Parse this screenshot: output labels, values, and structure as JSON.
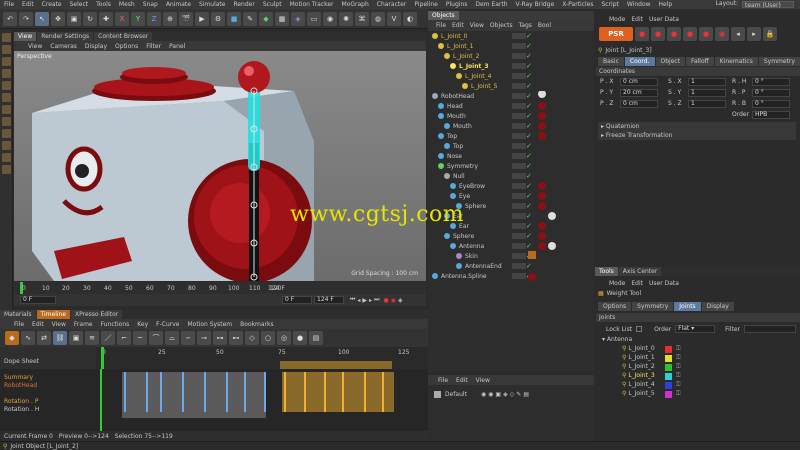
{
  "menubar": {
    "items": [
      "File",
      "Edit",
      "Create",
      "Select",
      "Tools",
      "Mesh",
      "Snap",
      "Animate",
      "Simulate",
      "Render",
      "Sculpt",
      "Motion Tracker",
      "MoGraph",
      "Character",
      "Pipeline",
      "Plugins",
      "Dem Earth",
      "V-Ray Bridge",
      "X-Particles",
      "Script",
      "Window",
      "Help"
    ],
    "layout_label": "Layout:",
    "layout_value": "team (User)"
  },
  "viewport": {
    "tabs": [
      "View",
      "Render Settings",
      "Content Browser"
    ],
    "menu": [
      "View",
      "Cameras",
      "Display",
      "Options",
      "Filter",
      "Panel"
    ],
    "camera_label": "Perspective",
    "grid_spacing": "Grid Spacing : 100 cm"
  },
  "ruler": {
    "ticks": [
      "0",
      "10",
      "20",
      "30",
      "40",
      "50",
      "60",
      "70",
      "80",
      "90",
      "100",
      "110",
      "120"
    ],
    "end_frame": "124 F"
  },
  "transport": {
    "current": "0 F",
    "start": "0 F",
    "end": "124 F",
    "field2": "0 F"
  },
  "bottom": {
    "tabs": [
      "Materials",
      "Timeline",
      "XPresso Editor"
    ],
    "menu": [
      "File",
      "Edit",
      "View",
      "Frame",
      "Functions",
      "Key",
      "F-Curve",
      "Motion System",
      "Bookmarks"
    ],
    "dopesheet_label": "Dope Sheet",
    "ruler_ticks": [
      "0",
      "25",
      "50",
      "75",
      "100",
      "125"
    ],
    "tracks": [
      {
        "name": "Summary",
        "color": "#e0a23a"
      },
      {
        "name": "RobotHead",
        "color": "#e07030"
      },
      {
        "name": "Rotation . P",
        "color": "#e0a23a"
      },
      {
        "name": "Rotation . H",
        "color": "#c8c8c8"
      }
    ],
    "status": {
      "current_frame": "Current Frame  0",
      "preview": "Preview  0-->124",
      "selection": "Selection  75-->119"
    }
  },
  "footer": {
    "status": "Joint Object [L_Joint_2]"
  },
  "objects": {
    "tab": "Objects",
    "menu": [
      "File",
      "Edit",
      "View",
      "Objects",
      "Tags",
      "Bool"
    ],
    "items": [
      {
        "name": "L_Joint_0",
        "depth": 0,
        "color": "#e0c040",
        "highlight": true
      },
      {
        "name": "L_Joint_1",
        "depth": 1,
        "color": "#e0c040",
        "highlight": true
      },
      {
        "name": "L_Joint_2",
        "depth": 2,
        "color": "#e0c040",
        "highlight": true
      },
      {
        "name": "L_Joint_3",
        "depth": 3,
        "color": "#ffe060",
        "highlight": true,
        "selected": true
      },
      {
        "name": "L_Joint_4",
        "depth": 4,
        "color": "#e0c040",
        "highlight": true
      },
      {
        "name": "L_Joint_5",
        "depth": 5,
        "color": "#e0c040",
        "highlight": true
      },
      {
        "name": "RobotHead",
        "depth": 0,
        "color": "#c8c8c8"
      },
      {
        "name": "Head",
        "depth": 1,
        "color": "#c8c8c8"
      },
      {
        "name": "Mouth",
        "depth": 1,
        "color": "#c8c8c8"
      },
      {
        "name": "Mouth",
        "depth": 2,
        "color": "#c8c8c8"
      },
      {
        "name": "Top",
        "depth": 1,
        "color": "#c8c8c8"
      },
      {
        "name": "Top",
        "depth": 2,
        "color": "#c8c8c8"
      },
      {
        "name": "Nose",
        "depth": 1,
        "color": "#c8c8c8"
      },
      {
        "name": "Symmetry",
        "depth": 1,
        "color": "#c8c8c8"
      },
      {
        "name": "Null",
        "depth": 2,
        "color": "#c8c8c8"
      },
      {
        "name": "EyeBrow",
        "depth": 3,
        "color": "#c8c8c8"
      },
      {
        "name": "Eye",
        "depth": 3,
        "color": "#c8c8c8"
      },
      {
        "name": "Sphere",
        "depth": 4,
        "color": "#c8c8c8"
      },
      {
        "name": "Ear",
        "depth": 2,
        "color": "#c8c8c8"
      },
      {
        "name": "Ear",
        "depth": 3,
        "color": "#c8c8c8"
      },
      {
        "name": "Sphere",
        "depth": 2,
        "color": "#c8c8c8"
      },
      {
        "name": "Antenna",
        "depth": 3,
        "color": "#c8c8c8"
      },
      {
        "name": "Skin",
        "depth": 4,
        "color": "#c8c8c8"
      },
      {
        "name": "AntennaEnd",
        "depth": 4,
        "color": "#c8c8c8"
      },
      {
        "name": "Antenna.Spline",
        "depth": 0,
        "color": "#c8c8c8"
      }
    ],
    "bottom_menu": [
      "File",
      "Edit",
      "View"
    ],
    "layer": "Default"
  },
  "attributes": {
    "menu": [
      "Mode",
      "Edit",
      "User Data"
    ],
    "title": "Joint [L_Joint_3]",
    "subtabs": [
      "Basic",
      "Coord.",
      "Object",
      "Falloff",
      "Kinematics",
      "Symmetry"
    ],
    "active_subtab": "Coord.",
    "section": "Coordinates",
    "coords": [
      {
        "axis_p": "P . X",
        "val_p": "0 cm",
        "axis_s": "S . X",
        "val_s": "1",
        "axis_r": "R . H",
        "val_r": "0 °"
      },
      {
        "axis_p": "P . Y",
        "val_p": "20 cm",
        "axis_s": "S . Y",
        "val_s": "1",
        "axis_r": "R . P",
        "val_r": "0 °"
      },
      {
        "axis_p": "P . Z",
        "val_p": "0 cm",
        "axis_s": "S . Z",
        "val_s": "1",
        "axis_r": "R . B",
        "val_r": "0 °"
      }
    ],
    "order_label": "Order",
    "order_value": "HPB",
    "quaternion": "▸ Quaternion",
    "freeze": "▸ Freeze Transformation"
  },
  "tools": {
    "tabs": [
      "Tools",
      "Axis Center"
    ],
    "menu": [
      "Mode",
      "Edit",
      "User Data"
    ],
    "title": "Weight Tool",
    "subtabs": [
      "Options",
      "Symmetry",
      "Joints",
      "Display"
    ],
    "active_subtab": "Joints",
    "section": "Joints",
    "lock_list": "Lock List",
    "order_label": "Order",
    "order_value": "Flat",
    "filter_label": "Filter",
    "joints": [
      {
        "name": "Antenna",
        "color": ""
      },
      {
        "name": "L_Joint_0",
        "color": "#e03030"
      },
      {
        "name": "L_Joint_1",
        "color": "#e0e030"
      },
      {
        "name": "L_Joint_2",
        "color": "#30c030"
      },
      {
        "name": "L_Joint_3",
        "color": "#30d0d0"
      },
      {
        "name": "L_Joint_4",
        "color": "#3040e0"
      },
      {
        "name": "L_Joint_5",
        "color": "#d030d0"
      }
    ]
  },
  "watermark": "www.cgtsj.com"
}
